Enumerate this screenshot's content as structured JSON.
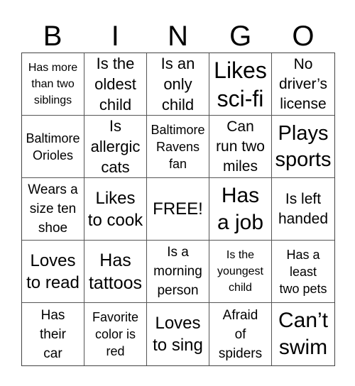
{
  "header": {
    "letters": [
      "B",
      "I",
      "N",
      "G",
      "O"
    ]
  },
  "cells": [
    "Has more\nthan two\nsiblings",
    "Is the\noldest\nchild",
    "Is an\nonly\nchild",
    "Likes\nsci-fi",
    "No\ndriver’s\nlicense",
    "Baltimore\nOrioles",
    "Is\nallergic\ncats",
    "Baltimore\nRavens\nfan",
    "Can\nrun two\nmiles",
    "Plays\nsports",
    "Wears a\nsize ten\nshoe",
    "Likes\nto cook",
    "FREE!",
    "Has\na job",
    "Is left\nhanded",
    "Loves\nto read",
    "Has\ntattoos",
    "Is a\nmorning\nperson",
    "Is the\nyoungest\nchild",
    "Has a\nleast\ntwo pets",
    "Has\ntheir\ncar",
    "Favorite\ncolor is\nred",
    "Loves\nto sing",
    "Afraid\nof\nspiders",
    "Can’t\nswim"
  ]
}
